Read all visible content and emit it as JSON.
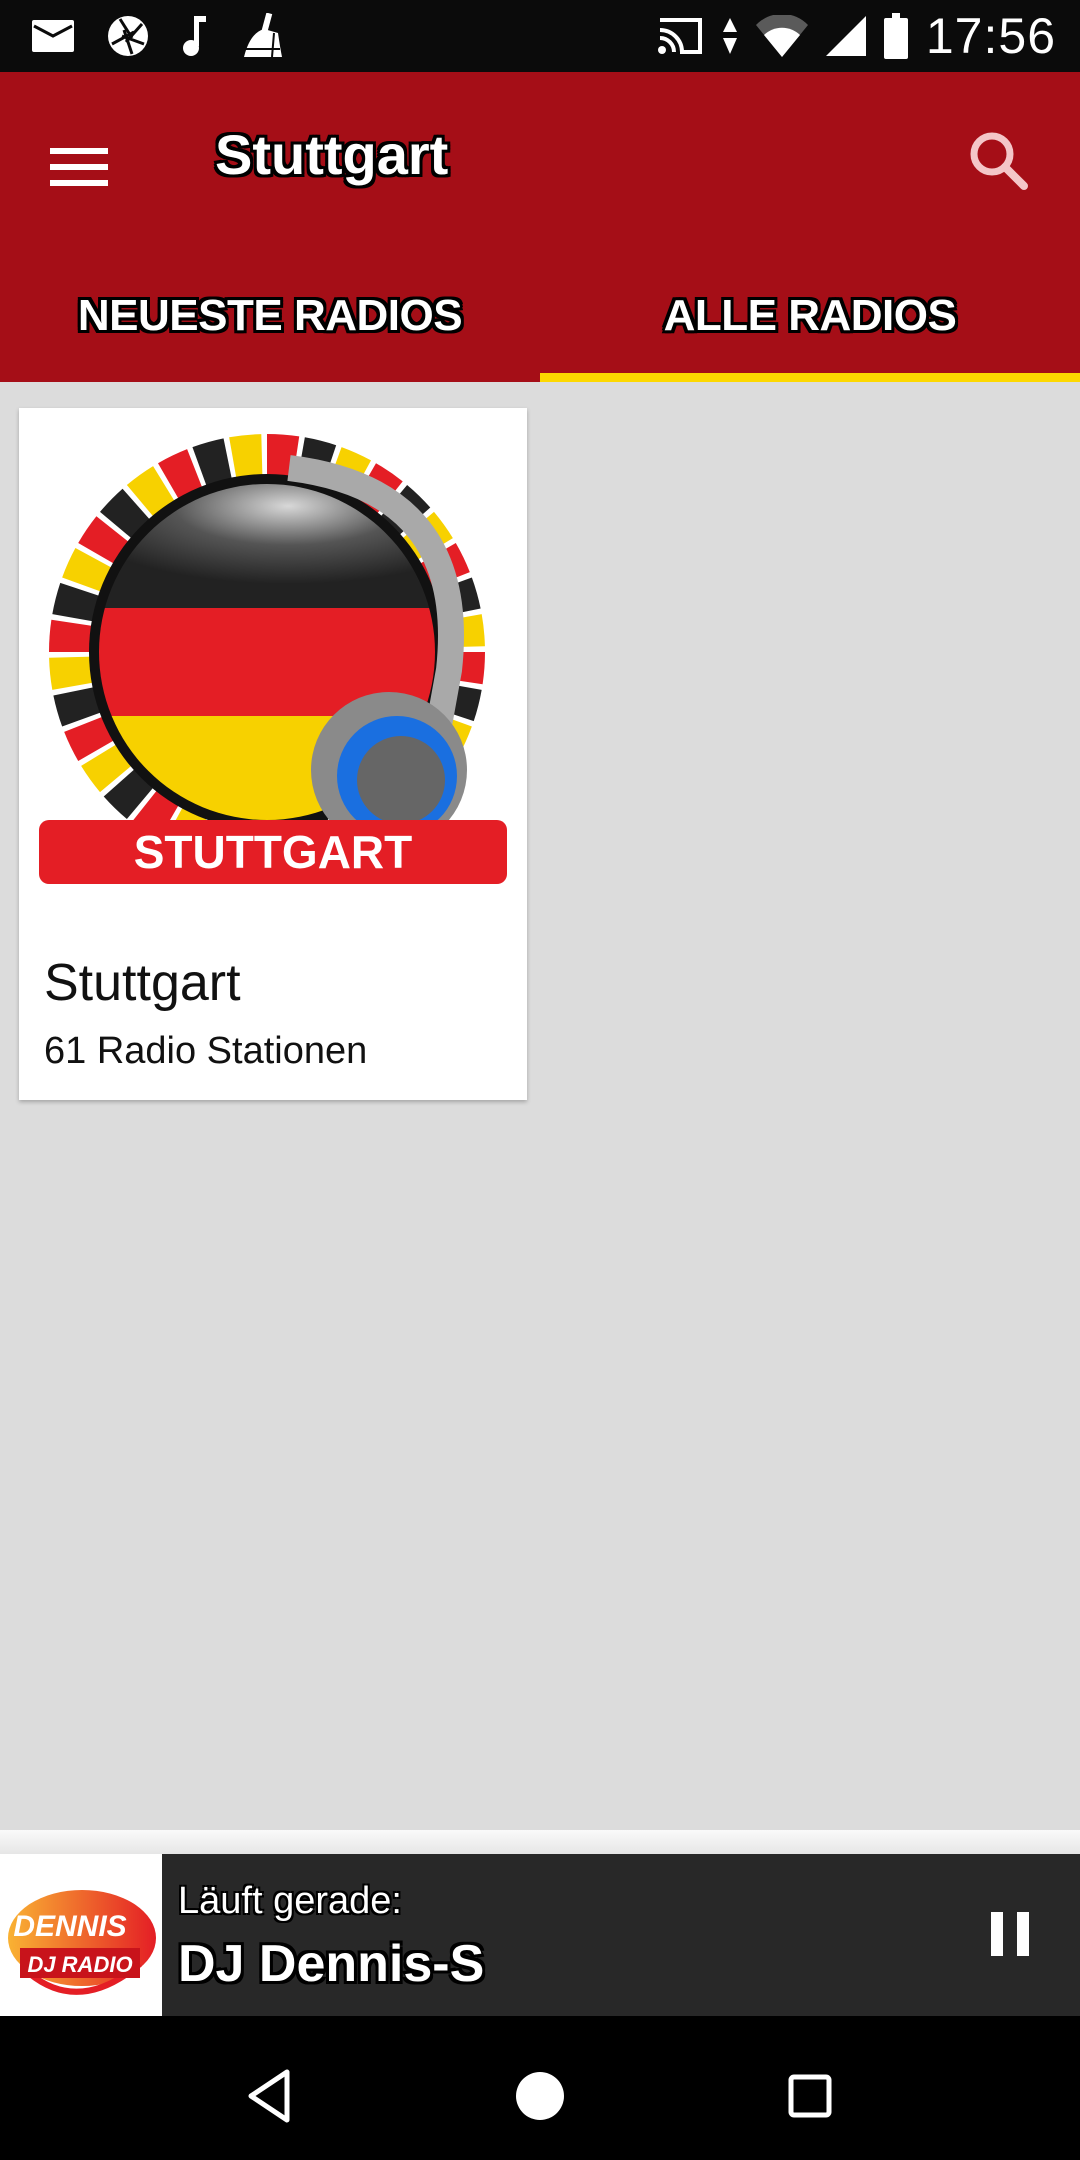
{
  "status_bar": {
    "time": "17:56",
    "left_icons": [
      "mail-icon",
      "camera-aperture-icon",
      "music-note-icon",
      "broom-icon"
    ],
    "right_icons": [
      "cast-icon",
      "data-arrows-icon",
      "wifi-icon",
      "cell-signal-icon",
      "battery-icon"
    ]
  },
  "app_bar": {
    "title": "Stuttgart",
    "menu_icon": "hamburger-menu-icon",
    "search_icon": "search-icon",
    "background_color": "#a50e17"
  },
  "tabs": [
    {
      "label": "NEUESTE RADIOS",
      "active": false
    },
    {
      "label": "ALLE RADIOS",
      "active": true
    }
  ],
  "tab_indicator_color": "#fdd800",
  "cards": [
    {
      "image_label": "STUTTGART",
      "title": "Stuttgart",
      "subtitle": "61 Radio Stationen"
    }
  ],
  "player": {
    "label": "Läuft gerade:",
    "station": "DJ Dennis-S",
    "logo_line1": "DENNIS",
    "logo_line2": "DJ RADIO",
    "control_icon": "pause-icon"
  },
  "nav_bar": {
    "buttons": [
      "back-icon",
      "home-icon",
      "recents-icon"
    ]
  }
}
